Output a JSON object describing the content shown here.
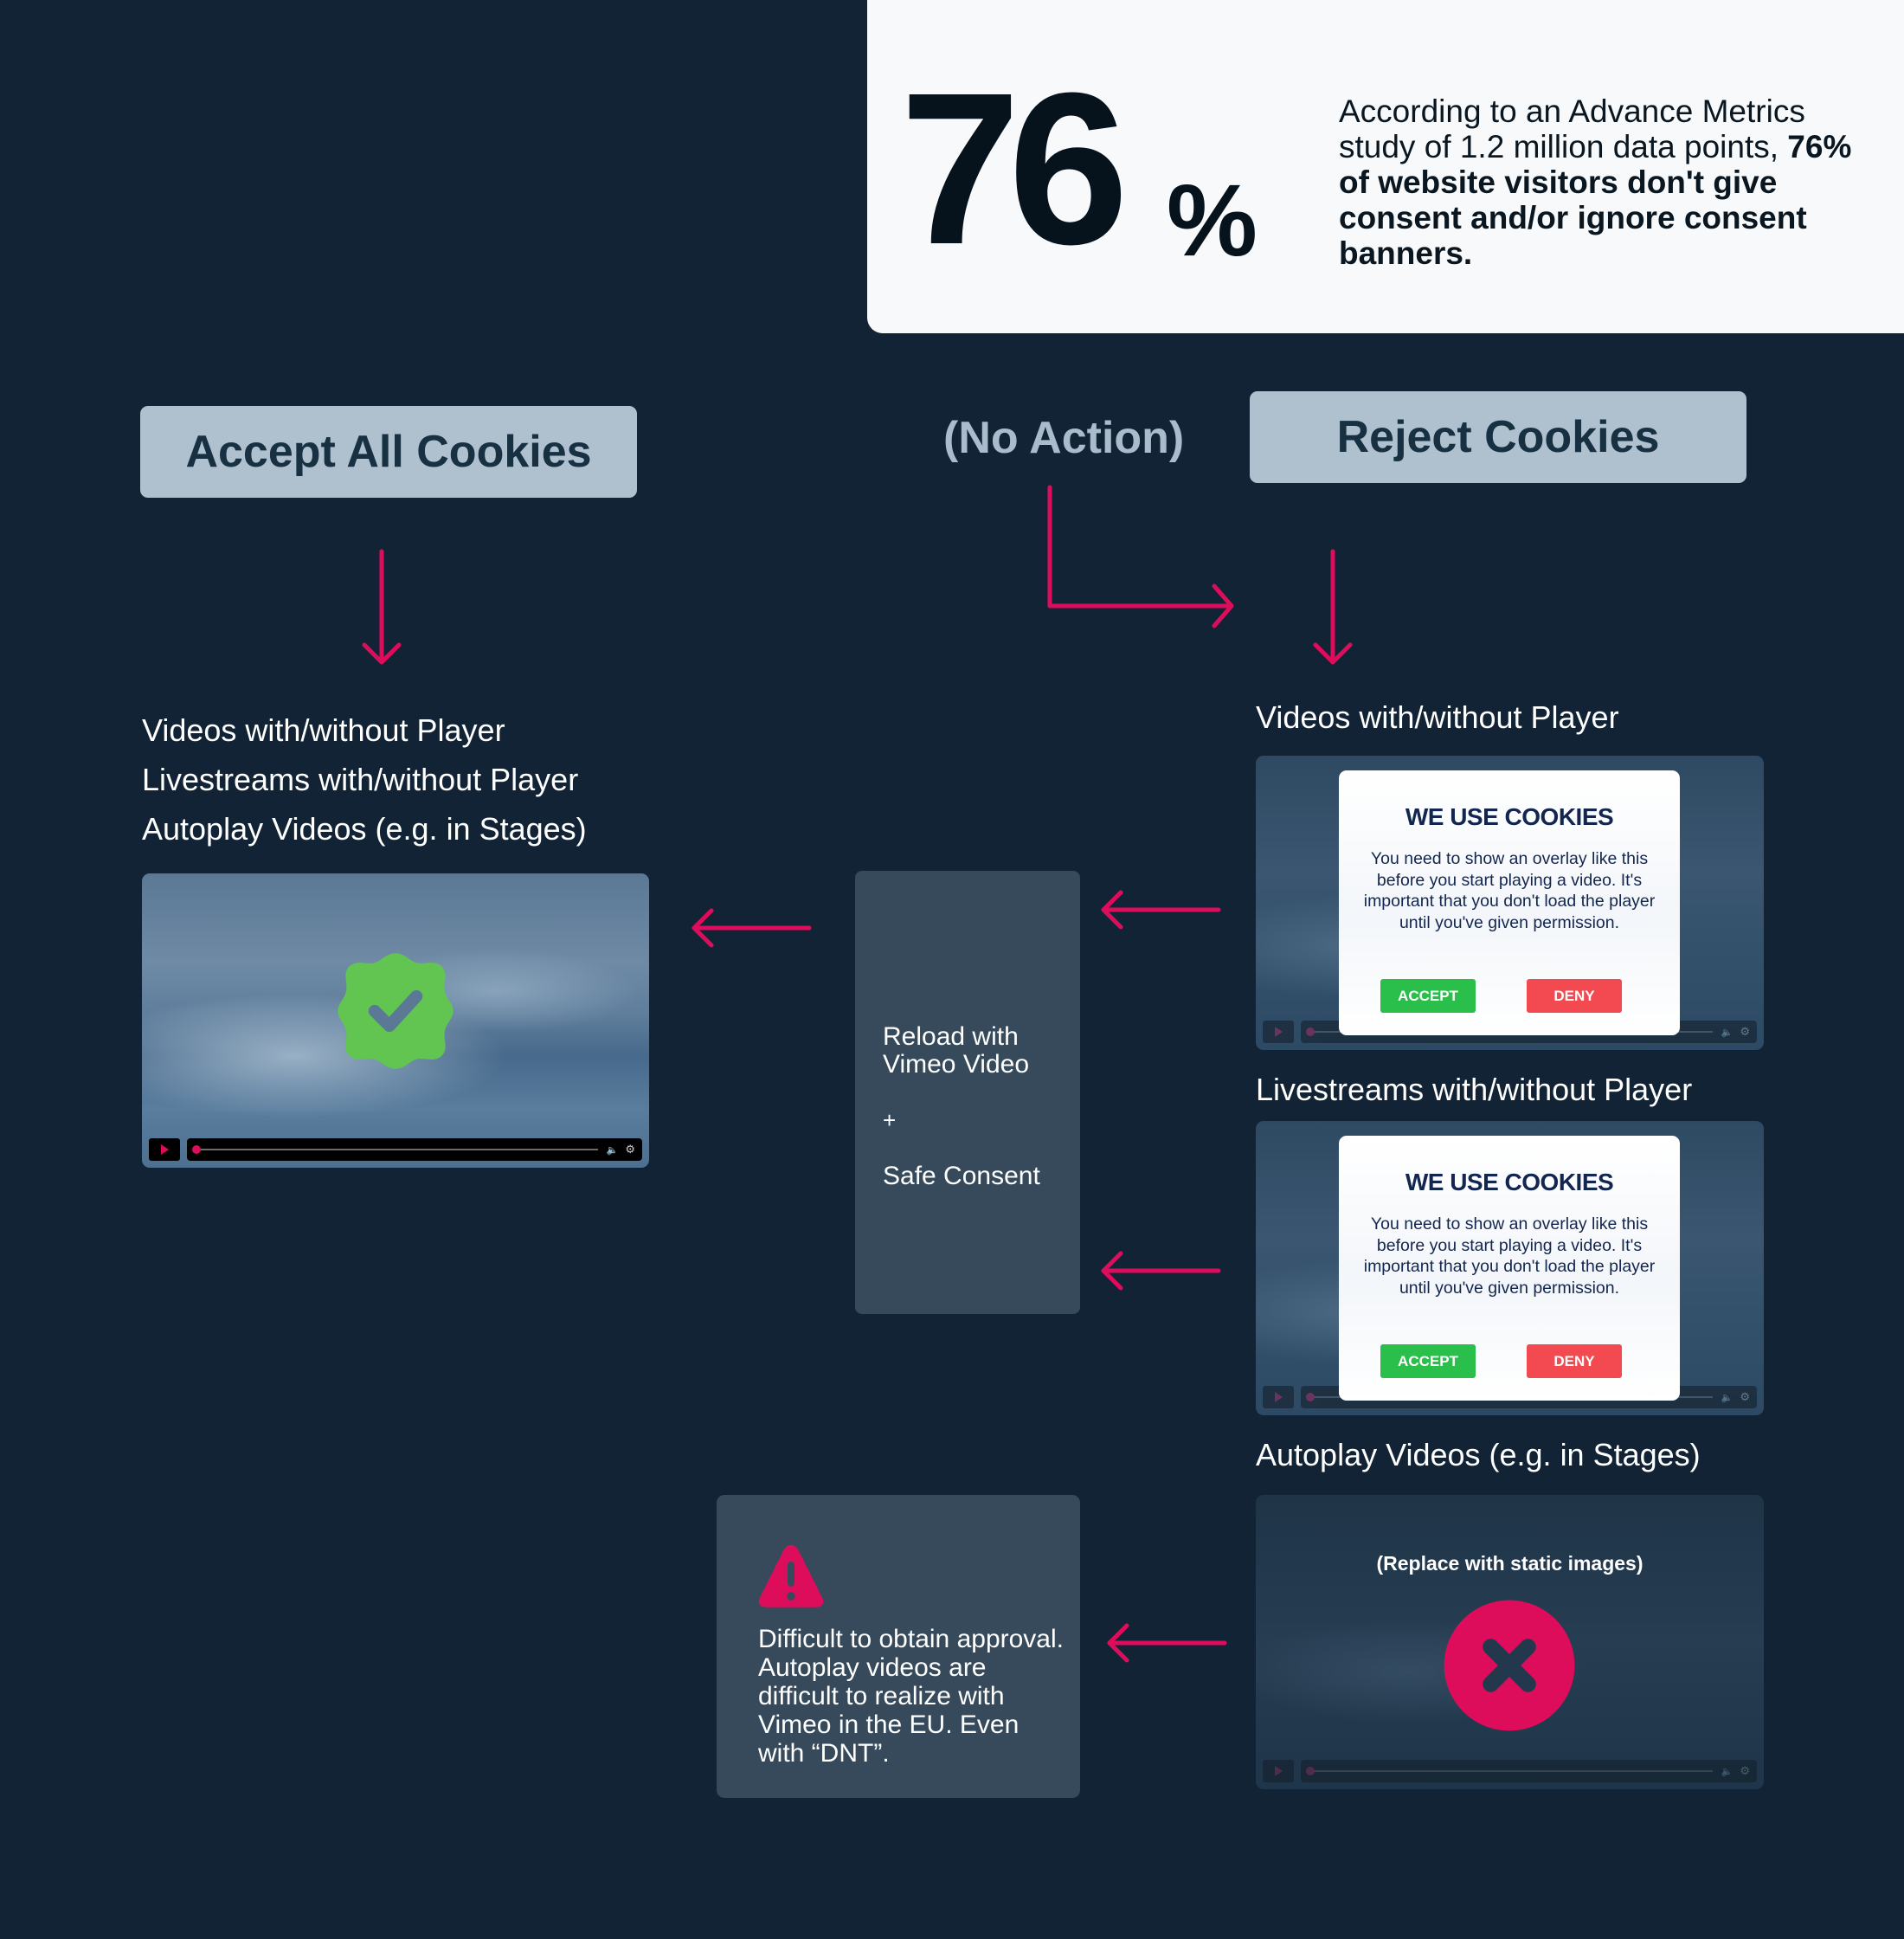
{
  "stat": {
    "number": "76",
    "percent": "%",
    "description_plain": "According to an Advance Metrics study of 1.2 million data points,",
    "description_bold": "76% of website visitors don't give consent and/or ignore consent banners."
  },
  "choices": {
    "accept_all": "Accept All Cookies",
    "no_action": "(No Action)",
    "reject": "Reject Cookies"
  },
  "accept_path": {
    "items": [
      "Videos with/without Player",
      "Livestreams with/without Player",
      "Autoplay Videos (e.g. in Stages)"
    ],
    "video_overlay_icon": "verified-check-badge-icon"
  },
  "reload_box": {
    "line1": "Reload with",
    "line2": "Vimeo Video",
    "plus": "+",
    "line3": "Safe Consent"
  },
  "reject_path": {
    "sections": [
      {
        "label": "Videos with/without Player",
        "modal": {
          "title": "WE USE COOKIES",
          "body": "You need to show an overlay like this before you start playing a video. It's important that you don't load the player until you've given permission.",
          "accept": "ACCEPT",
          "deny": "DENY"
        }
      },
      {
        "label": "Livestreams with/without Player",
        "modal": {
          "title": "WE USE COOKIES",
          "body": "You need to show an overlay like this before you start playing a video. It's important that you don't load the player until you've given permission.",
          "accept": "ACCEPT",
          "deny": "DENY"
        }
      },
      {
        "label": "Autoplay Videos (e.g. in Stages)",
        "overlay_text": "(Replace with static images)",
        "overlay_icon": "blocked-x-circle-icon"
      }
    ]
  },
  "warning": {
    "icon": "warning-triangle-icon",
    "text": "Difficult to obtain approval. Autoplay videos are difficult to realize with Vimeo in the EU. Even with “DNT”."
  },
  "colors": {
    "background": "#112335",
    "card": "#f7f9fb",
    "button": "#afc1cf",
    "accent_arrow": "#dd0d5b",
    "success": "#62c552",
    "accept_green": "#2abf4a",
    "deny_red": "#f24a50",
    "box": "#364a5b"
  }
}
